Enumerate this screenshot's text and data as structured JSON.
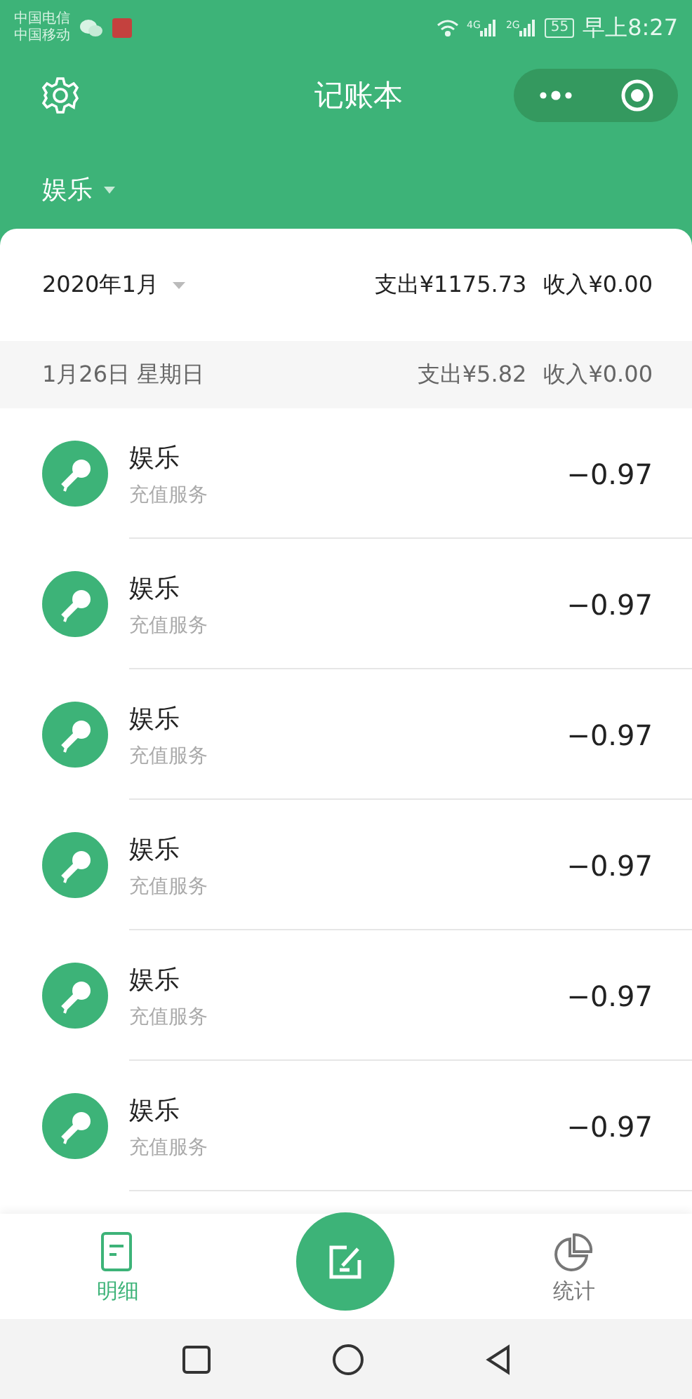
{
  "status_bar": {
    "carriers": [
      "中国电信",
      "中国移动"
    ],
    "network_labels": [
      "4G",
      "2G"
    ],
    "battery": "55",
    "time": "早上8:27"
  },
  "header": {
    "title": "记账本"
  },
  "category": {
    "label": "娱乐"
  },
  "summary": {
    "month": "2020年1月",
    "expense": "支出¥1175.73",
    "income": "收入¥0.00"
  },
  "day": {
    "date": "1月26日 星期日",
    "expense": "支出¥5.82",
    "income": "收入¥0.00"
  },
  "entries": [
    {
      "title": "娱乐",
      "subtitle": "充值服务",
      "amount": "−0.97"
    },
    {
      "title": "娱乐",
      "subtitle": "充值服务",
      "amount": "−0.97"
    },
    {
      "title": "娱乐",
      "subtitle": "充值服务",
      "amount": "−0.97"
    },
    {
      "title": "娱乐",
      "subtitle": "充值服务",
      "amount": "−0.97"
    },
    {
      "title": "娱乐",
      "subtitle": "充值服务",
      "amount": "−0.97"
    },
    {
      "title": "娱乐",
      "subtitle": "充值服务",
      "amount": "−0.97"
    }
  ],
  "tab_bar": [
    {
      "kind": "details",
      "label": "明细",
      "selected": true
    },
    {
      "kind": "add"
    },
    {
      "kind": "stats",
      "label": "统计",
      "selected": false
    }
  ]
}
